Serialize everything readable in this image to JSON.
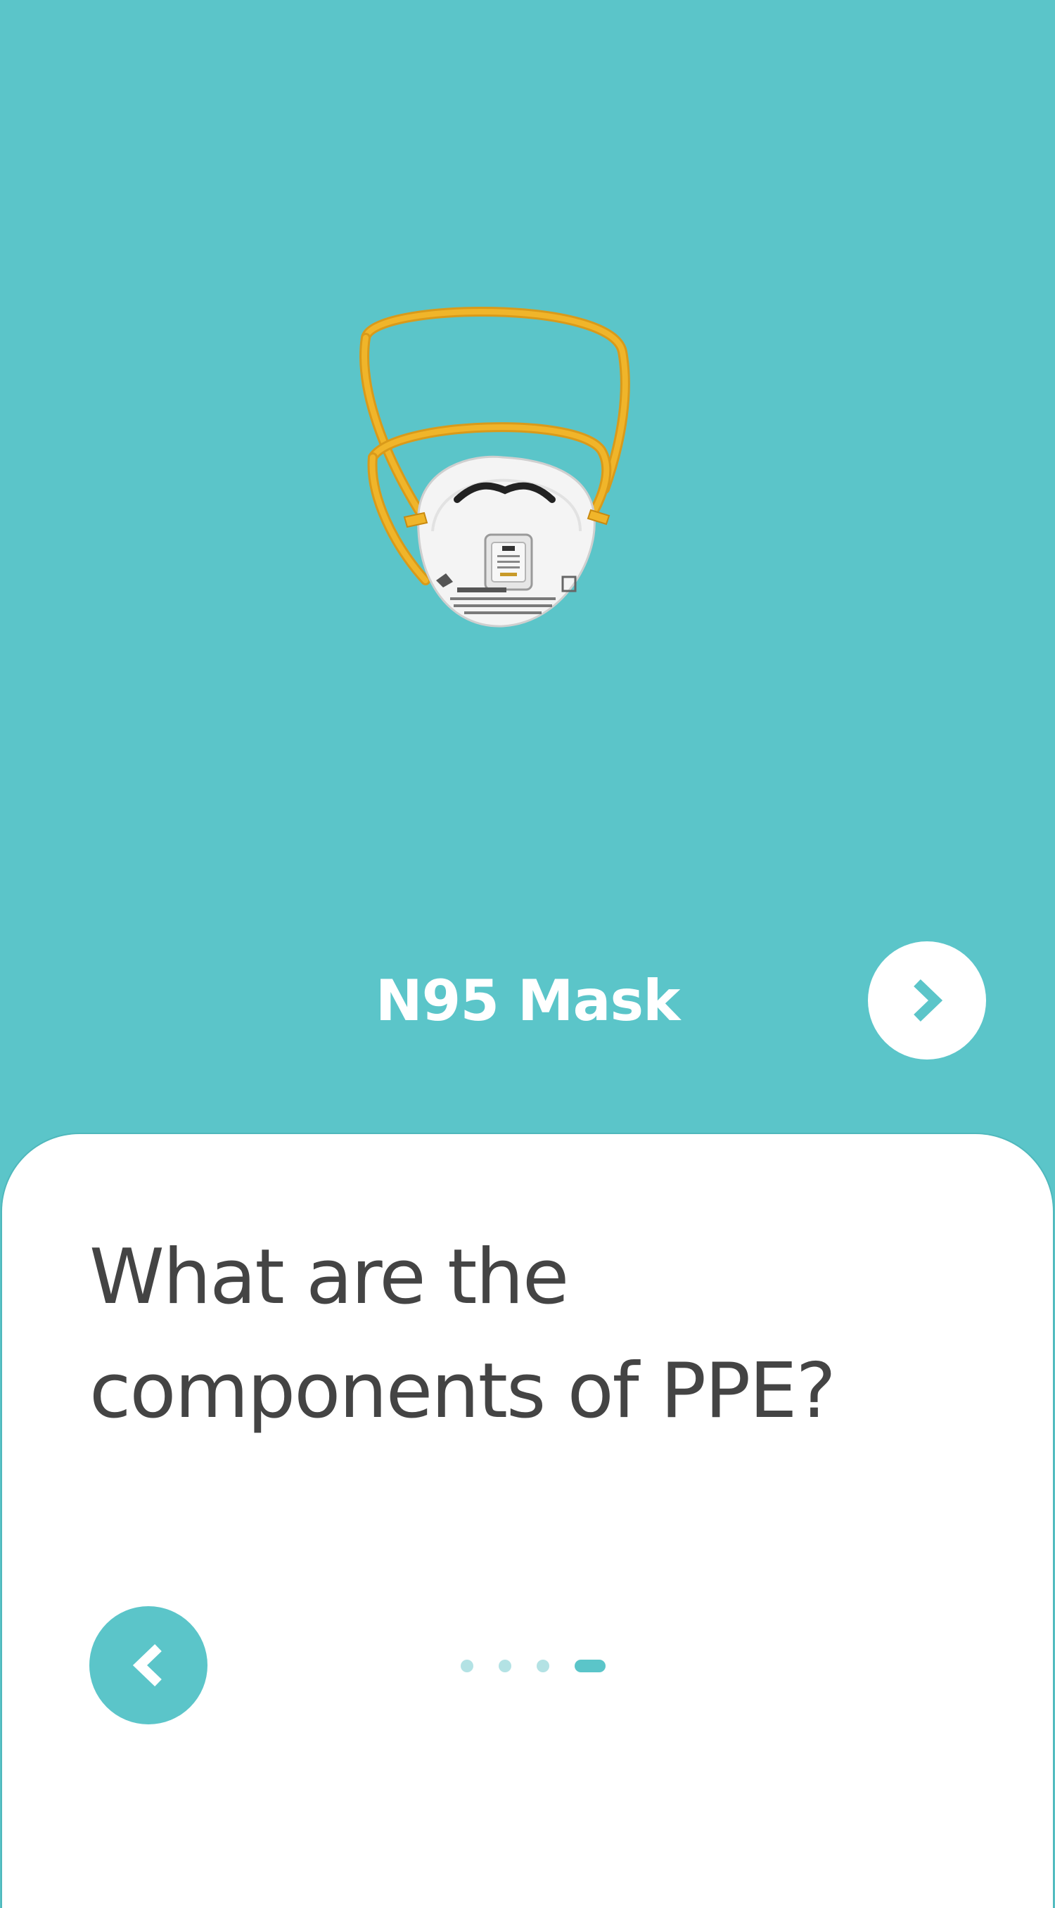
{
  "card": {
    "item_title": "N95 Mask",
    "question": "What are the components of PPE?"
  },
  "navigation": {
    "next_icon": "chevron-right-icon",
    "prev_icon": "chevron-left-icon"
  },
  "pager": {
    "total": 4,
    "current": 4
  },
  "colors": {
    "accent": "#5bc5c9",
    "background_card": "#ffffff",
    "text_dark": "#444444",
    "dot_inactive": "#b3e2e4",
    "strap": "#f0b52a"
  }
}
